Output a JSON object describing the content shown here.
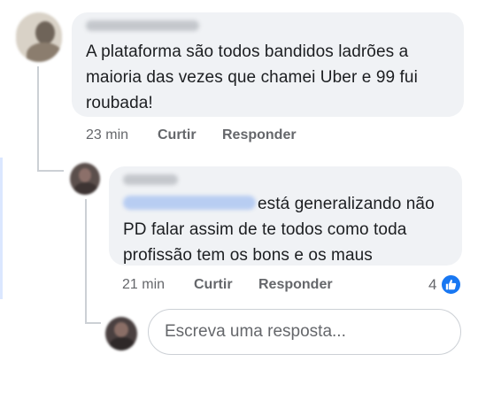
{
  "comment": {
    "text": "A plataforma são todos bandidos ladrões a\nmaioria das vezes que chamei Uber e 99 fui\nroubada!",
    "time": "23 min",
    "like_label": "Curtir",
    "reply_label": "Responder"
  },
  "reply": {
    "text_after_mention": "está generalizando não",
    "text_rest": "PD falar assim de te todos como toda\nprofissão tem os bons e os maus",
    "time": "21 min",
    "like_label": "Curtir",
    "reply_label": "Responder",
    "reaction_count": "4",
    "reaction_icon": "thumbs-up-icon",
    "reaction_color": "#1877f2"
  },
  "reply_input": {
    "placeholder": "Escreva uma resposta..."
  }
}
